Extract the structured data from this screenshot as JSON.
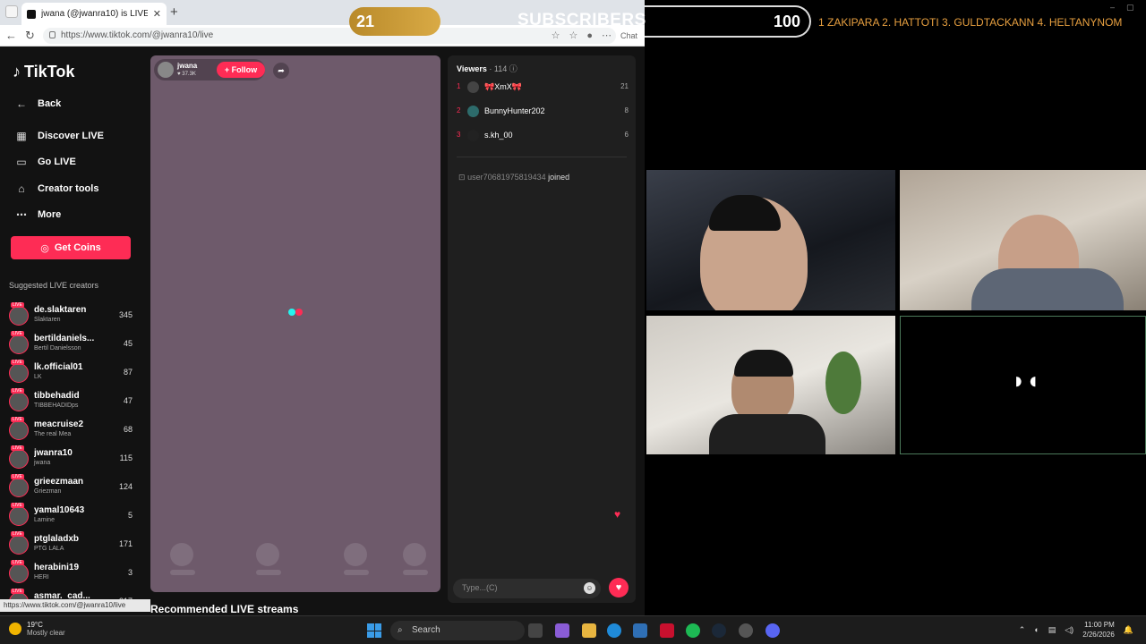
{
  "browser": {
    "tab_title": "jwana (@jwanra10) is LIVE - TikTok",
    "url": "https://www.tiktok.com/@jwanra10/live",
    "copilot_label": "Chat"
  },
  "sidebar": {
    "logo": "TikTok",
    "back": "Back",
    "nav": [
      {
        "label": "Discover LIVE",
        "icon": "calendar-icon"
      },
      {
        "label": "Go LIVE",
        "icon": "video-camera-icon"
      },
      {
        "label": "Creator tools",
        "icon": "home-icon"
      },
      {
        "label": "More",
        "icon": "more-dots-icon"
      }
    ],
    "get_coins": "Get Coins",
    "suggested_title": "Suggested LIVE creators",
    "live_badge": "LIVE",
    "creators": [
      {
        "name": "de.slaktaren",
        "sub": "Slaktaren",
        "count": "345"
      },
      {
        "name": "bertildaniels...",
        "sub": "Bertil Danielsson",
        "count": "45"
      },
      {
        "name": "lk.official01",
        "sub": "LK",
        "count": "87"
      },
      {
        "name": "tibbehadid",
        "sub": "TIBBEHADIDps",
        "count": "47"
      },
      {
        "name": "meacruise2",
        "sub": "The real Mea",
        "count": "68"
      },
      {
        "name": "jwanra10",
        "sub": "jwana",
        "count": "115"
      },
      {
        "name": "grieezmaan",
        "sub": "Griezman",
        "count": "124"
      },
      {
        "name": "yamal10643",
        "sub": "Lamine",
        "count": "5"
      },
      {
        "name": "ptglaladxb",
        "sub": "PTG LALA",
        "count": "171"
      },
      {
        "name": "herabini19",
        "sub": "HERI",
        "count": "3"
      },
      {
        "name": "asmar._cad...",
        "sub": "",
        "count": "317"
      }
    ],
    "status_url": "https://www.tiktok.com/@jwanra10/live"
  },
  "stream": {
    "host_name": "jwana",
    "host_likes": "37.3K",
    "follow": "+ Follow",
    "recommended": "Recommended LIVE streams"
  },
  "chat": {
    "viewers_label": "Viewers",
    "viewers_count": "· 114",
    "top_viewers": [
      {
        "rank": "1",
        "name": "🎀XmX🎀",
        "score": "21"
      },
      {
        "rank": "2",
        "name": "BunnyHunter202",
        "score": "8"
      },
      {
        "rank": "3",
        "name": "s.kh_00",
        "score": "6"
      }
    ],
    "join_user": "user70681975819434",
    "join_word": "joined",
    "input_placeholder": "Type...(C)"
  },
  "overlay": {
    "sub_count": "21",
    "sub_label": "SUBSCRIBERS",
    "goal": "100",
    "ticker": "1 ZAKIPARA 2. HATTOTI 3. GULDTACKANN 4. HELTANYNOM"
  },
  "taskbar": {
    "temp": "19°C",
    "weather": "Mostly clear",
    "search": "Search",
    "time": "11:00 PM",
    "date": "2/26/2026"
  }
}
